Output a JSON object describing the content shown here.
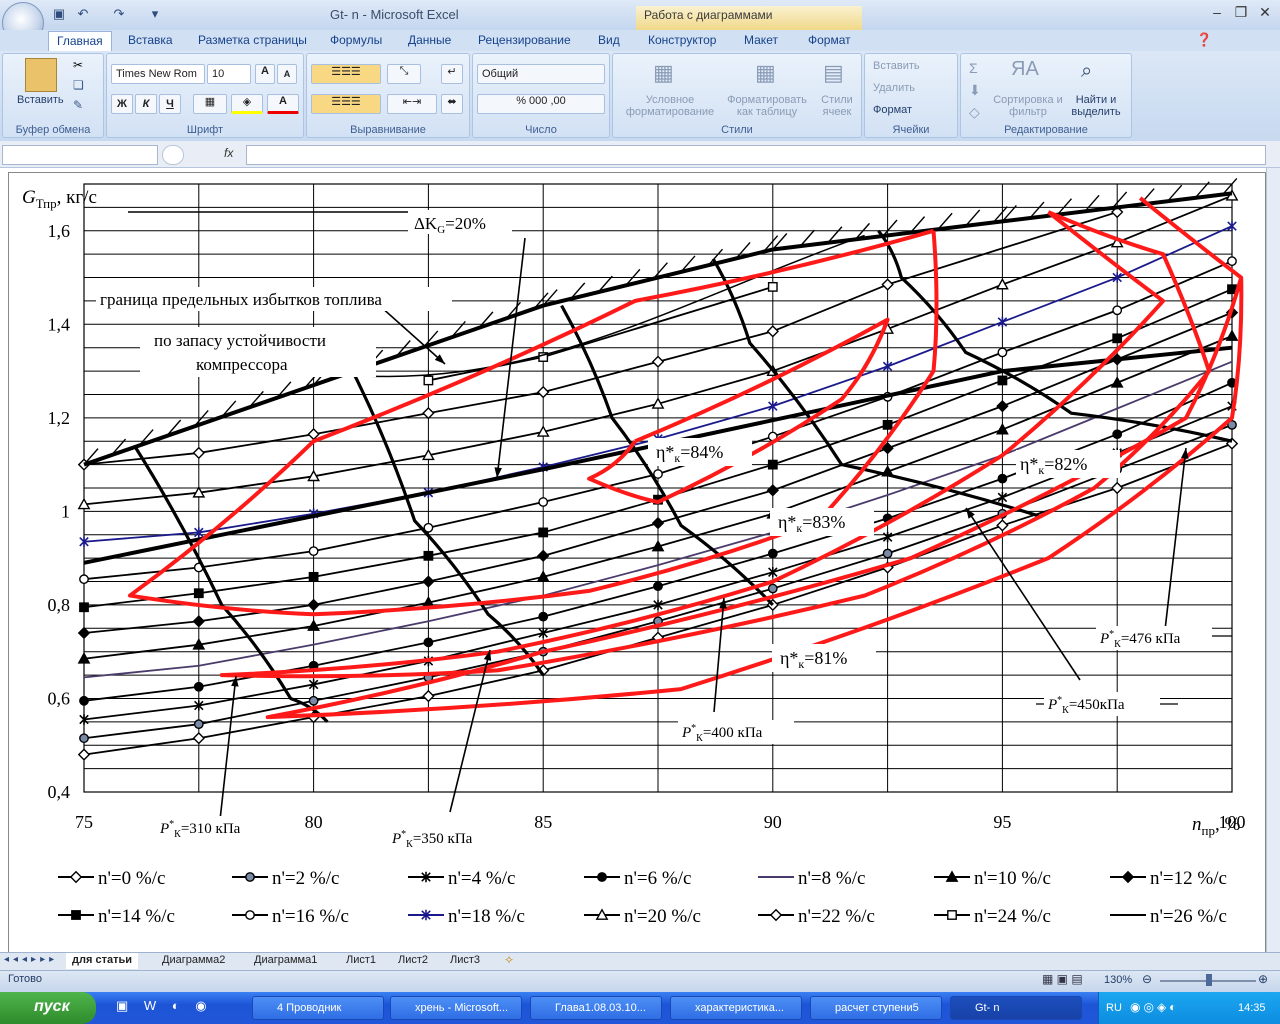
{
  "window": {
    "title": "Gt- n - Microsoft Excel",
    "context_tab": "Работа с диаграммами"
  },
  "ribbon": {
    "tabs": [
      "Главная",
      "Вставка",
      "Разметка страницы",
      "Формулы",
      "Данные",
      "Рецензирование",
      "Вид",
      "Конструктор",
      "Макет",
      "Формат"
    ],
    "clipboard": {
      "paste": "Вставить",
      "label": "Буфер обмена"
    },
    "font": {
      "name": "Times New Rom",
      "size": "10",
      "bold": "Ж",
      "italic": "К",
      "underline": "Ч",
      "label": "Шрифт"
    },
    "alignment": {
      "label": "Выравнивание"
    },
    "number": {
      "format": "Общий",
      "label": "Число"
    },
    "styles": {
      "conditional": "Условное форматирование",
      "as_table": "Форматировать как таблицу",
      "cell_styles": "Стили ячеек",
      "label": "Стили"
    },
    "cells": {
      "insert": "Вставить",
      "delete": "Удалить",
      "format": "Формат",
      "label": "Ячейки"
    },
    "editing": {
      "sort": "Сортировка и фильтр",
      "find": "Найти и выделить",
      "label": "Редактирование"
    }
  },
  "formula_bar": {
    "fx": "fx",
    "value": ""
  },
  "sheet_tabs": [
    "для статьи",
    "Диаграмма2",
    "Диаграмма1",
    "Лист1",
    "Лист2",
    "Лист3"
  ],
  "status": {
    "text": "Готово",
    "zoom": "130%"
  },
  "taskbar": {
    "start": "пуск",
    "tasks": [
      "4 Проводник",
      "хрень - Microsoft...",
      "Глава1.08.03.10...",
      "характеристика...",
      "расчет ступени5",
      "Gt- n"
    ],
    "lang": "RU",
    "clock": "14:35"
  },
  "colors": {
    "red": "#ff1a1a",
    "navy": "#1a1a8c",
    "purple": "#4b3b6b",
    "black": "#000000"
  },
  "chart_data": {
    "type": "line",
    "ylabel_main": "G",
    "ylabel_sub": "Тпр",
    "ylabel_unit": ", кг/с",
    "xlabel_main": "n",
    "xlabel_sub": "пр",
    "xlabel_unit": ", %",
    "xlim": [
      75,
      100
    ],
    "ylim": [
      0.4,
      1.7
    ],
    "xticks": [
      "75",
      "80",
      "85",
      "90",
      "95",
      "100"
    ],
    "xtick_values": [
      75,
      80,
      85,
      90,
      95,
      100
    ],
    "yticks": [
      "0,4",
      "0,6",
      "0,8",
      "1",
      "1,2",
      "1,4",
      "1,6"
    ],
    "ytick_values": [
      0.4,
      0.6,
      0.8,
      1.0,
      1.2,
      1.4,
      1.6
    ],
    "x_points": [
      75,
      77.5,
      80,
      82.5,
      85,
      87.5,
      90,
      92.5,
      95,
      97.5,
      100
    ],
    "series": [
      {
        "name": "n'=0 %/с",
        "marker": "diamond-open",
        "color": "#000000",
        "values": [
          0.48,
          0.515,
          0.56,
          0.605,
          0.66,
          0.73,
          0.8,
          0.88,
          0.97,
          1.05,
          1.145
        ]
      },
      {
        "name": "n'=2 %/с",
        "marker": "circle-gray",
        "color": "#000000",
        "values": [
          0.515,
          0.545,
          0.595,
          0.645,
          0.7,
          0.765,
          0.835,
          0.91,
          0.995,
          1.09,
          1.185
        ]
      },
      {
        "name": "n'=4 %/с",
        "marker": "star",
        "color": "#000000",
        "values": [
          0.555,
          0.585,
          0.63,
          0.68,
          0.74,
          0.8,
          0.87,
          0.945,
          1.03,
          1.125,
          1.225
        ]
      },
      {
        "name": "n'=6 %/с",
        "marker": "circle-filled",
        "color": "#000000",
        "values": [
          0.595,
          0.625,
          0.67,
          0.72,
          0.775,
          0.84,
          0.91,
          0.985,
          1.07,
          1.165,
          1.275
        ]
      },
      {
        "name": "n'=8 %/с",
        "marker": "none",
        "color": "#4b3b6b",
        "values": [
          0.645,
          0.67,
          0.715,
          0.765,
          0.82,
          0.885,
          0.955,
          1.035,
          1.12,
          1.22,
          1.32
        ]
      },
      {
        "name": "n'=10 %/с",
        "marker": "triangle-filled",
        "color": "#000000",
        "values": [
          0.685,
          0.715,
          0.755,
          0.805,
          0.86,
          0.925,
          0.995,
          1.085,
          1.175,
          1.275,
          1.375
        ]
      },
      {
        "name": "n'=12 %/с",
        "marker": "diamond-filled",
        "color": "#000000",
        "values": [
          0.74,
          0.765,
          0.8,
          0.85,
          0.905,
          0.975,
          1.045,
          1.135,
          1.225,
          1.325,
          1.425
        ]
      },
      {
        "name": "n'=14 %/с",
        "marker": "square-filled",
        "color": "#000000",
        "values": [
          0.795,
          0.825,
          0.86,
          0.905,
          0.955,
          1.025,
          1.1,
          1.185,
          1.28,
          1.37,
          1.475
        ]
      },
      {
        "name": "n'=16 %/с",
        "marker": "circle-open",
        "color": "#000000",
        "values": [
          0.855,
          0.88,
          0.915,
          0.965,
          1.02,
          1.08,
          1.16,
          1.245,
          1.34,
          1.43,
          1.535
        ]
      },
      {
        "name": "n'=18 %/с",
        "marker": "star",
        "color": "#1a1a8c",
        "values": [
          0.935,
          0.955,
          0.995,
          1.04,
          1.095,
          1.155,
          1.225,
          1.31,
          1.405,
          1.5,
          1.61
        ]
      },
      {
        "name": "n'=20 %/с",
        "marker": "triangle-open",
        "color": "#000000",
        "values": [
          1.015,
          1.04,
          1.075,
          1.12,
          1.17,
          1.23,
          1.3,
          1.39,
          1.485,
          1.575,
          1.675
        ]
      },
      {
        "name": "n'=22 %/с",
        "marker": "diamond-open",
        "color": "#000000",
        "values": [
          1.1,
          1.125,
          1.165,
          1.21,
          1.255,
          1.32,
          1.385,
          1.485,
          null,
          1.64,
          null
        ]
      },
      {
        "name": "n'=24 %/с",
        "marker": "square-open",
        "color": "#000000",
        "values": [
          null,
          null,
          null,
          1.28,
          1.33,
          null,
          1.48,
          null,
          null,
          null,
          null
        ]
      },
      {
        "name": "n'=26 %/с",
        "marker": "none",
        "color": "#000000",
        "values": []
      }
    ],
    "surge_line": {
      "x": [
        75,
        80,
        85,
        90,
        95,
        100
      ],
      "y": [
        1.1,
        1.27,
        1.44,
        1.56,
        1.62,
        1.68
      ]
    },
    "delta_line": {
      "x": [
        75,
        85,
        95,
        100
      ],
      "y": [
        0.89,
        1.09,
        1.3,
        1.35
      ]
    },
    "annotations": {
      "delta": "ΔK",
      "delta_sub": "G",
      "delta_val": "=20%",
      "boundary": "граница предельных избытков топлива",
      "stability1": "по запасу устойчивости",
      "stability2": "компрессора",
      "eta84": "=84%",
      "eta83": "=83%",
      "eta82": "=82%",
      "eta81": "=81%",
      "eta_sym": "η*",
      "eta_sub": "к",
      "p310": "=310 кПа",
      "p350": "=350 кПа",
      "p400": "=400 кПа",
      "p450": "=450кПа",
      "p476": "=476 кПа",
      "p_sym": "P",
      "p_sub": "К"
    }
  }
}
